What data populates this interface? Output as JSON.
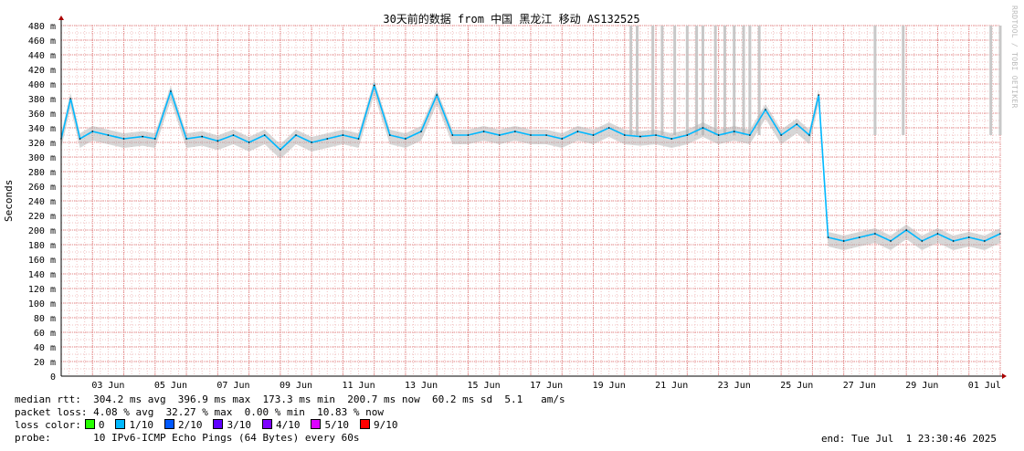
{
  "chart_data": {
    "type": "line",
    "title": "30天前的数据 from 中国 黑龙江 移动 AS132525",
    "ylabel": "Seconds",
    "ylim": [
      0,
      0.48
    ],
    "y_ticks": [
      "0",
      "20 m",
      "40 m",
      "60 m",
      "80 m",
      "100 m",
      "120 m",
      "140 m",
      "160 m",
      "180 m",
      "200 m",
      "220 m",
      "240 m",
      "260 m",
      "280 m",
      "300 m",
      "320 m",
      "340 m",
      "360 m",
      "380 m",
      "400 m",
      "420 m",
      "440 m",
      "460 m",
      "480 m"
    ],
    "x_ticks": [
      "03 Jun",
      "05 Jun",
      "07 Jun",
      "09 Jun",
      "11 Jun",
      "13 Jun",
      "15 Jun",
      "17 Jun",
      "19 Jun",
      "21 Jun",
      "23 Jun",
      "25 Jun",
      "27 Jun",
      "29 Jun",
      "01 Jul"
    ],
    "x_range_days": [
      1.0,
      31.0
    ],
    "grid": true,
    "series": [
      {
        "name": "median rtt",
        "x_days": [
          1.0,
          1.3,
          1.6,
          2.0,
          2.5,
          3.0,
          3.6,
          4.0,
          4.5,
          5.0,
          5.5,
          6.0,
          6.5,
          7.0,
          7.5,
          8.0,
          8.5,
          9.0,
          9.5,
          10.0,
          10.5,
          11.0,
          11.5,
          12.0,
          12.5,
          13.0,
          13.5,
          14.0,
          14.5,
          15.0,
          15.5,
          16.0,
          16.5,
          17.0,
          17.5,
          18.0,
          18.5,
          19.0,
          19.5,
          20.0,
          20.5,
          21.0,
          21.5,
          22.0,
          22.5,
          23.0,
          23.5,
          24.0,
          24.5,
          24.9,
          25.2,
          25.5,
          26.0,
          26.5,
          27.0,
          27.5,
          28.0,
          28.5,
          29.0,
          29.5,
          30.0,
          30.5,
          31.0
        ],
        "values": [
          0.325,
          0.38,
          0.325,
          0.335,
          0.33,
          0.325,
          0.328,
          0.325,
          0.39,
          0.325,
          0.328,
          0.322,
          0.33,
          0.32,
          0.33,
          0.31,
          0.33,
          0.32,
          0.325,
          0.33,
          0.325,
          0.398,
          0.33,
          0.325,
          0.335,
          0.385,
          0.33,
          0.33,
          0.335,
          0.33,
          0.335,
          0.33,
          0.33,
          0.325,
          0.335,
          0.33,
          0.34,
          0.33,
          0.328,
          0.33,
          0.325,
          0.33,
          0.34,
          0.33,
          0.335,
          0.33,
          0.365,
          0.33,
          0.345,
          0.33,
          0.385,
          0.19,
          0.185,
          0.19,
          0.195,
          0.185,
          0.2,
          0.185,
          0.195,
          0.185,
          0.19,
          0.185,
          0.195
        ]
      }
    ],
    "loss_spike_days": [
      19.2,
      19.4,
      19.9,
      20.2,
      20.6,
      21.0,
      21.3,
      21.5,
      21.9,
      22.2,
      22.5,
      22.8,
      23.0,
      23.3,
      27.0,
      27.9,
      30.7,
      31.0
    ]
  },
  "stats": {
    "median_rtt": "median rtt:  304.2 ms avg  396.9 ms max  173.3 ms min  200.7 ms now  60.2 ms sd  5.1   am/s",
    "packet_loss": "packet loss: 4.08 % avg  32.27 % max  0.00 % min  10.83 % now",
    "loss_color_label": "loss color:",
    "probe": "probe:       10 IPv6-ICMP Echo Pings (64 Bytes) every 60s",
    "end": "end: Tue Jul  1 23:30:46 2025"
  },
  "loss_colors": [
    {
      "label": "0",
      "color": "#26ff00"
    },
    {
      "label": "1/10",
      "color": "#00b8ff"
    },
    {
      "label": "2/10",
      "color": "#0059ff"
    },
    {
      "label": "3/10",
      "color": "#5e00ff"
    },
    {
      "label": "4/10",
      "color": "#7e00ff"
    },
    {
      "label": "5/10",
      "color": "#dd00ff"
    },
    {
      "label": "9/10",
      "color": "#ff0000"
    }
  ],
  "watermark": "RRDTOOL / TOBI OETIKER"
}
